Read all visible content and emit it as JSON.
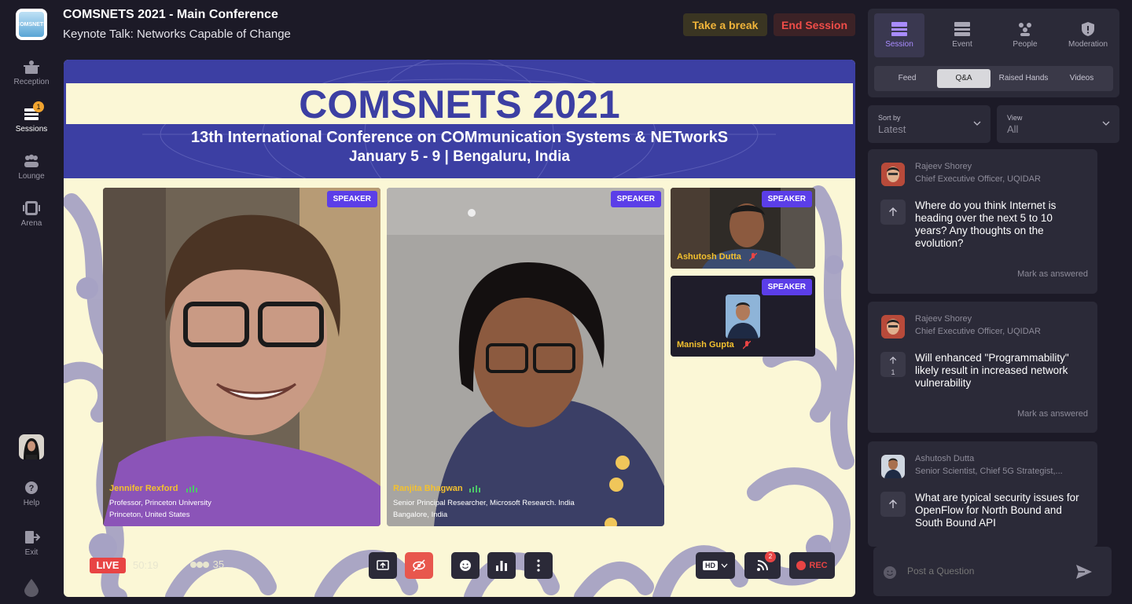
{
  "app": {
    "logo_text": "COMSNETS",
    "title": "COMSNETS 2021 - Main Conference",
    "subtitle": "Keynote Talk: Networks Capable of Change",
    "take_break": "Take a break",
    "end_session": "End Session"
  },
  "nav": {
    "items": [
      {
        "label": "Reception",
        "icon": "reception-icon"
      },
      {
        "label": "Sessions",
        "icon": "sessions-icon",
        "badge": "1"
      },
      {
        "label": "Lounge",
        "icon": "lounge-icon"
      },
      {
        "label": "Arena",
        "icon": "arena-icon"
      }
    ],
    "help": "Help",
    "exit": "Exit"
  },
  "banner": {
    "title": "COMSNETS 2021",
    "subtitle": "13th International Conference on COMmunication Systems & NETworkS",
    "dates": "January 5 - 9 | Bengaluru, India"
  },
  "speakers": [
    {
      "badge": "SPEAKER",
      "name": "Jennifer Rexford",
      "title": "Professor, Princeton University",
      "location": "Princeton, United States"
    },
    {
      "badge": "SPEAKER",
      "name": "Ranjita Bhagwan",
      "title": "Senior Principal Researcher, Microsoft Research. India",
      "location": "Bangalore, India"
    },
    {
      "badge": "SPEAKER",
      "name": "Ashutosh Dutta"
    },
    {
      "badge": "SPEAKER",
      "name": "Manish Gupta"
    }
  ],
  "controls": {
    "live": "LIVE",
    "timer": "50:19",
    "viewers": "35",
    "hd": "HD",
    "feed_badge": "2",
    "rec": "REC"
  },
  "panel": {
    "tabs": [
      "Session",
      "Event",
      "People",
      "Moderation"
    ],
    "active_tab": "Session",
    "subtabs": [
      "Feed",
      "Q&A",
      "Raised Hands",
      "Videos"
    ],
    "active_subtab": "Q&A",
    "sort": {
      "label": "Sort by",
      "value": "Latest"
    },
    "view": {
      "label": "View",
      "value": "All"
    },
    "questions": [
      {
        "name": "Rajeev Shorey",
        "role": "Chief Executive Officer, UQIDAR",
        "text": "Where do you think Internet is heading over the next 5 to 10 years? Any thoughts on the evolution?",
        "votes": "",
        "mark": "Mark as answered"
      },
      {
        "name": "Rajeev Shorey",
        "role": "Chief Executive Officer, UQIDAR",
        "text": "Will enhanced \"Programmability\" likely result in increased network vulnerability",
        "votes": "1",
        "mark": "Mark as answered"
      },
      {
        "name": "Ashutosh Dutta",
        "role": "Senior Scientist, Chief 5G Strategist,...",
        "text": "What are typical security issues for OpenFlow for North Bound and South Bound API",
        "votes": "",
        "mark": ""
      }
    ],
    "ask_placeholder": "Post a Question"
  },
  "colors": {
    "accent": "#5b3ee8",
    "live": "#e84444",
    "banner_blue": "#3c3fa3",
    "warn": "#f0b43a",
    "danger": "#ef4d48"
  }
}
